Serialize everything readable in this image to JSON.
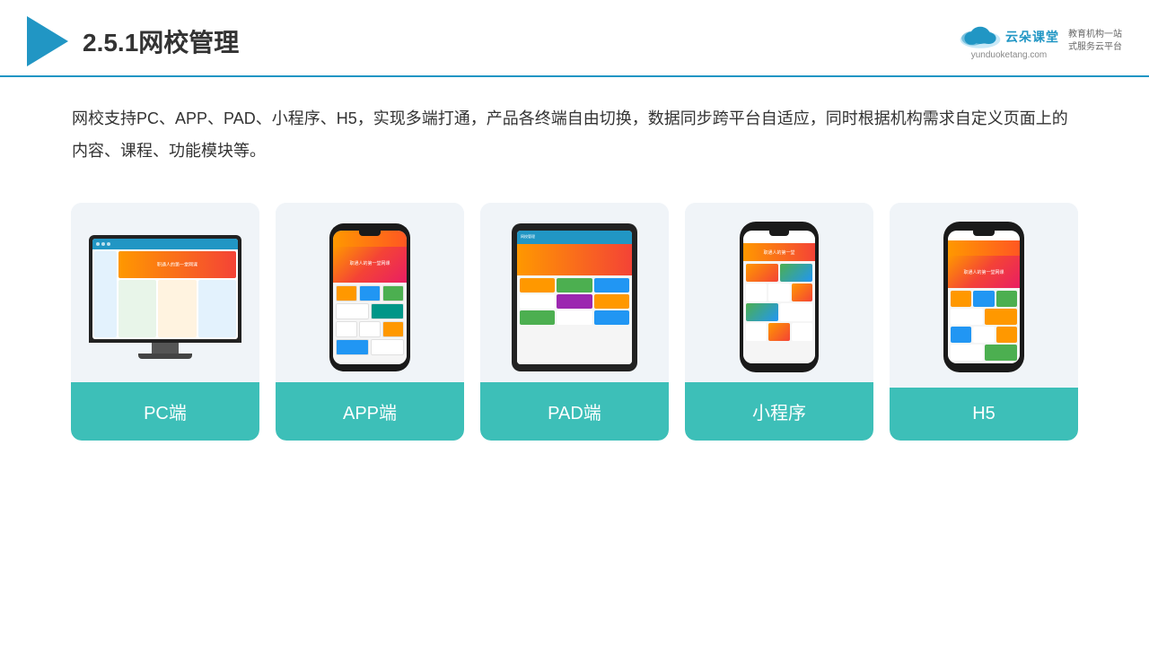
{
  "header": {
    "title": "2.5.1网校管理",
    "brand": {
      "name": "云朵课堂",
      "url": "yunduoketang.com",
      "tagline": "教育机构一站\n式服务云平台"
    }
  },
  "description": "网校支持PC、APP、PAD、小程序、H5，实现多端打通，产品各终端自由切换，数据同步跨平台自适应，同时根据机构需求自定义页面上的内容、课程、功能模块等。",
  "cards": [
    {
      "id": "pc",
      "label": "PC端"
    },
    {
      "id": "app",
      "label": "APP端"
    },
    {
      "id": "pad",
      "label": "PAD端"
    },
    {
      "id": "mini",
      "label": "小程序"
    },
    {
      "id": "h5",
      "label": "H5"
    }
  ],
  "colors": {
    "accent": "#2196c4",
    "teal": "#3dbfb8",
    "card_bg": "#f0f4f8"
  }
}
